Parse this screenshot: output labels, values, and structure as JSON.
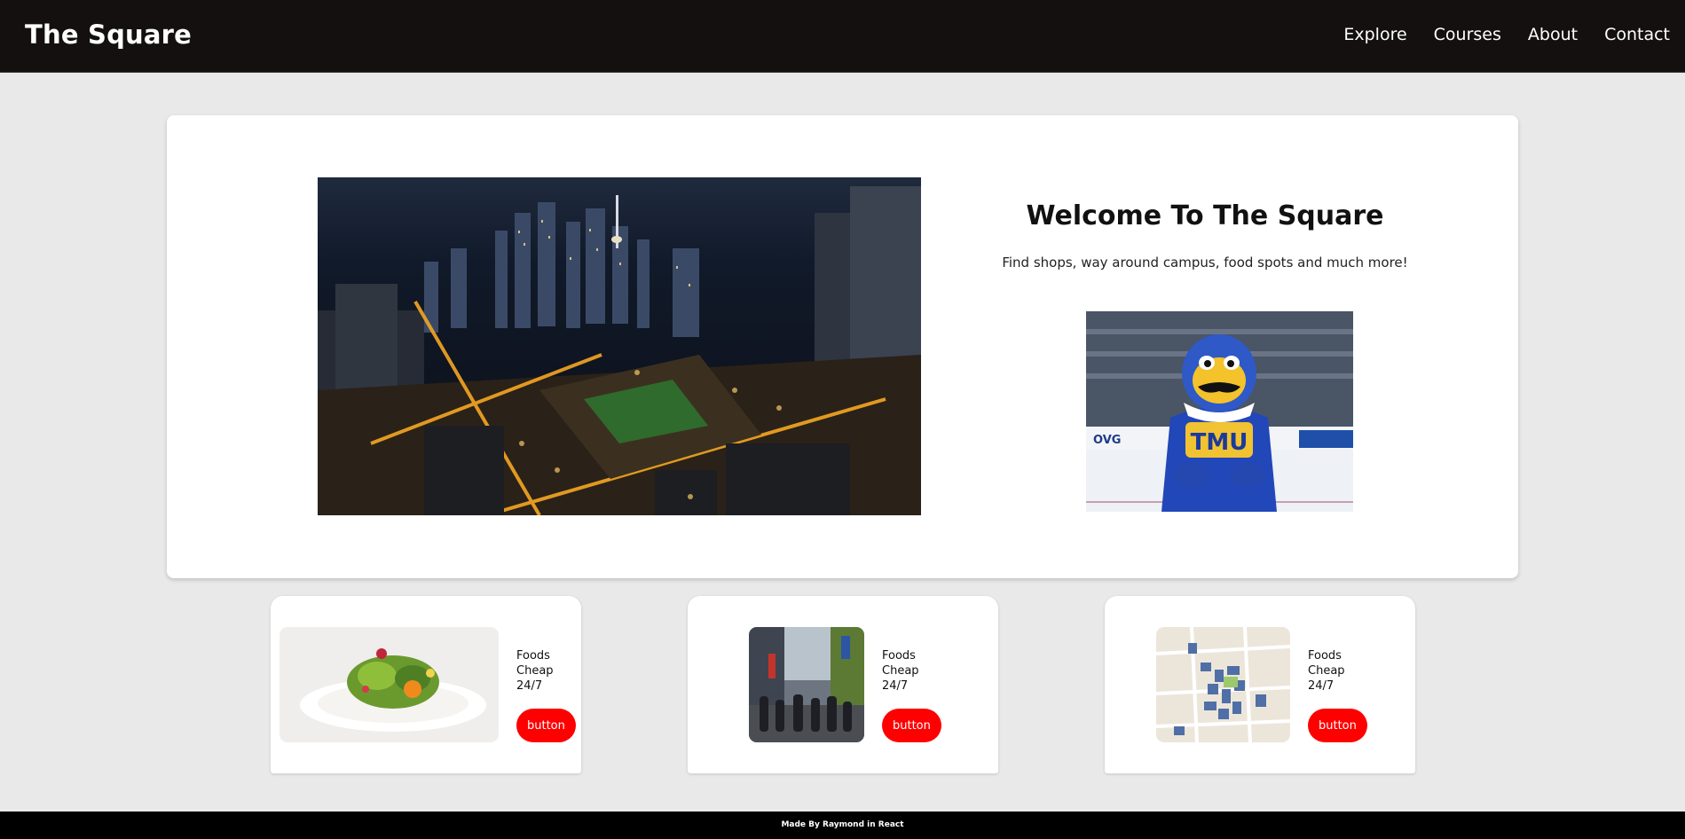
{
  "header": {
    "brand": "The Square",
    "nav": [
      "Explore",
      "Courses",
      "About",
      "Contact"
    ]
  },
  "hero": {
    "title": "Welcome To The Square",
    "subtitle": "Find shops, way around campus, food spots and much more!",
    "mascot_shirt_text": "TMU",
    "rink_board_text": "OVG"
  },
  "cards": [
    {
      "image": "salad-plate-photo",
      "lines": [
        "Foods",
        "Cheap",
        "24/7"
      ],
      "button": "button"
    },
    {
      "image": "street-crowd-photo",
      "lines": [
        "Foods",
        "Cheap",
        "24/7"
      ],
      "button": "button"
    },
    {
      "image": "campus-map-thumbnail",
      "lines": [
        "Foods",
        "Cheap",
        "24/7"
      ],
      "button": "button"
    }
  ],
  "footer": {
    "text": "Made By Raymond in React"
  },
  "colors": {
    "header_bg": "#141010",
    "page_bg": "#e9e9e9",
    "button_bg": "#ff0000",
    "footer_bg": "#000000"
  }
}
